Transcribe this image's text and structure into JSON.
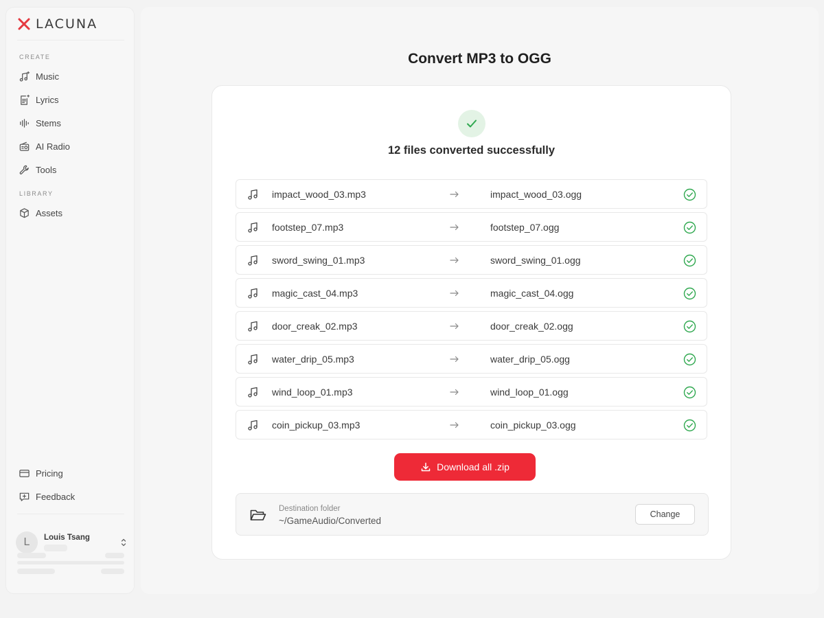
{
  "app": {
    "logo_text": "LACUNA",
    "brand_color": "#ee2a37"
  },
  "sidebar": {
    "create_label": "CREATE",
    "create_items": [
      {
        "label": "Music",
        "icon": "music-note-sparkle-icon"
      },
      {
        "label": "Lyrics",
        "icon": "document-sparkle-icon"
      },
      {
        "label": "Stems",
        "icon": "waveform-icon"
      },
      {
        "label": "AI Radio",
        "icon": "radio-icon"
      },
      {
        "label": "Tools",
        "icon": "wrench-icon"
      }
    ],
    "library_label": "LIBRARY",
    "library_items": [
      {
        "label": "Assets",
        "icon": "box-icon"
      }
    ],
    "footer_items": [
      {
        "label": "Pricing",
        "icon": "credit-card-icon"
      },
      {
        "label": "Feedback",
        "icon": "message-plus-icon"
      }
    ],
    "user": {
      "initial": "L",
      "name": "Louis Tsang"
    }
  },
  "main": {
    "title": "Convert MP3 to OGG",
    "status": "12 files converted successfully",
    "files": [
      {
        "source": "impact_wood_03.mp3",
        "output": "impact_wood_03.ogg"
      },
      {
        "source": "footstep_07.mp3",
        "output": "footstep_07.ogg"
      },
      {
        "source": "sword_swing_01.mp3",
        "output": "sword_swing_01.ogg"
      },
      {
        "source": "magic_cast_04.mp3",
        "output": "magic_cast_04.ogg"
      },
      {
        "source": "door_creak_02.mp3",
        "output": "door_creak_02.ogg"
      },
      {
        "source": "water_drip_05.mp3",
        "output": "water_drip_05.ogg"
      },
      {
        "source": "wind_loop_01.mp3",
        "output": "wind_loop_01.ogg"
      },
      {
        "source": "coin_pickup_03.mp3",
        "output": "coin_pickup_03.ogg"
      }
    ],
    "download_label": "Download all .zip",
    "destination": {
      "label": "Destination folder",
      "path": "~/GameAudio/Converted",
      "change_label": "Change"
    },
    "success_color": "#2fa84f"
  }
}
